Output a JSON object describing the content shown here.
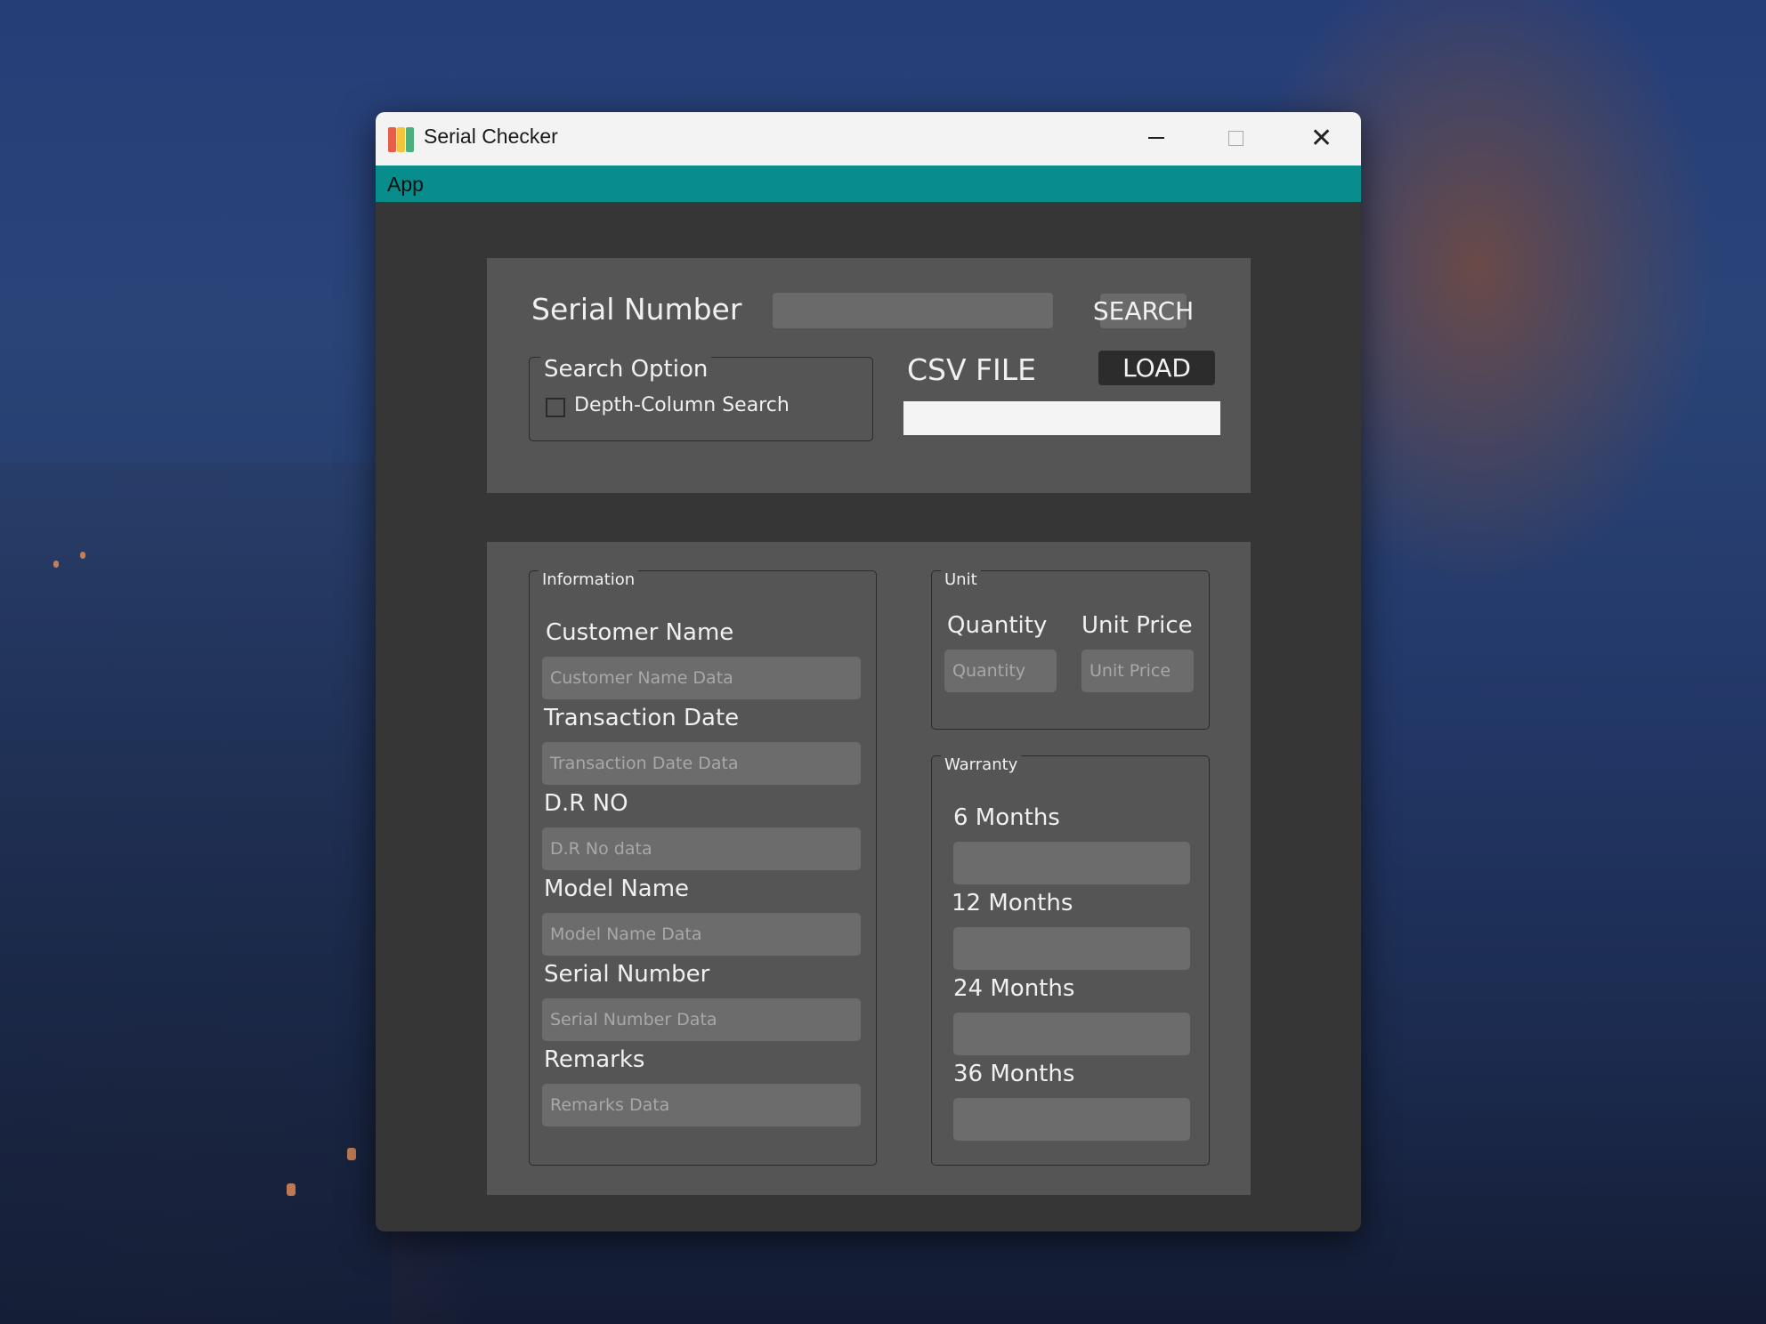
{
  "window": {
    "title": "Serial Checker"
  },
  "menu": {
    "items": [
      "App"
    ]
  },
  "search": {
    "serial_label": "Serial Number",
    "serial_value": "",
    "search_button": "SEARCH",
    "option_group_title": "Search Option",
    "depth_checkbox_label": "Depth-Column Search",
    "depth_checkbox_checked": false,
    "csv_label": "CSV FILE",
    "load_button": "LOAD",
    "csv_path": ""
  },
  "information": {
    "group_title": "Information",
    "fields": [
      {
        "label": "Customer Name",
        "placeholder": "Customer Name Data"
      },
      {
        "label": "Transaction Date",
        "placeholder": "Transaction Date Data"
      },
      {
        "label": "D.R NO",
        "placeholder": "D.R No data"
      },
      {
        "label": "Model Name",
        "placeholder": "Model Name Data"
      },
      {
        "label": "Serial Number",
        "placeholder": "Serial Number Data"
      },
      {
        "label": "Remarks",
        "placeholder": "Remarks Data"
      }
    ]
  },
  "unit": {
    "group_title": "Unit",
    "quantity_label": "Quantity",
    "quantity_placeholder": "Quantity",
    "unit_price_label": "Unit Price",
    "unit_price_placeholder": "Unit Price"
  },
  "warranty": {
    "group_title": "Warranty",
    "fields": [
      {
        "label": "6 Months",
        "value": ""
      },
      {
        "label": "12 Months",
        "value": ""
      },
      {
        "label": "24 Months",
        "value": ""
      },
      {
        "label": "36 Months",
        "value": ""
      }
    ]
  },
  "colors": {
    "menubar": "#088c8c",
    "window_bg": "#363636",
    "panel_bg": "#555555",
    "input_bg": "#6c6c6c",
    "load_button_bg": "#2c2c2c"
  }
}
